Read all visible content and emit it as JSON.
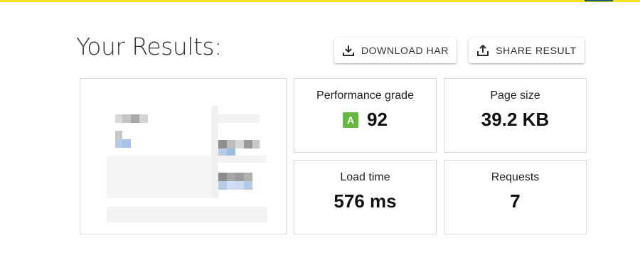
{
  "title": "Your Results:",
  "actions": {
    "download_label": "DOWNLOAD HAR",
    "share_label": "SHARE RESULT"
  },
  "metrics": {
    "grade": {
      "label": "Performance grade",
      "letter": "A",
      "value": "92"
    },
    "page_size": {
      "label": "Page size",
      "value": "39.2 KB"
    },
    "load_time": {
      "label": "Load time",
      "value": "576 ms"
    },
    "requests": {
      "label": "Requests",
      "value": "7"
    }
  },
  "colors": {
    "accent_bar": "#f4e21c",
    "grade_badge": "#66b843"
  },
  "icons": {
    "download": "download-icon",
    "share": "share-icon"
  }
}
